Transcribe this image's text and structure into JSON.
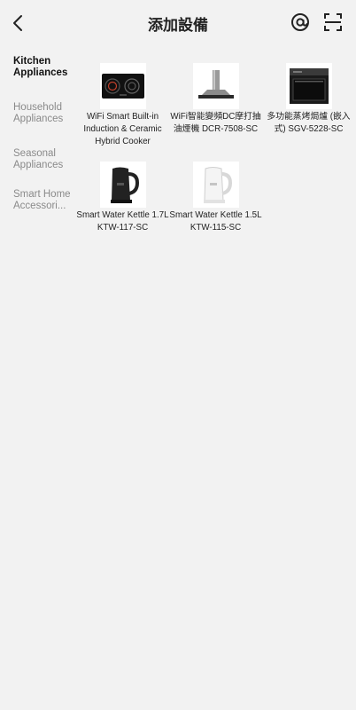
{
  "header": {
    "title": "添加設備"
  },
  "sidebar": {
    "items": [
      {
        "label": "Kitchen Appliances"
      },
      {
        "label": "Household Appliances"
      },
      {
        "label": "Seasonal Appliances"
      },
      {
        "label": "Smart Home Accessori..."
      }
    ]
  },
  "devices": [
    {
      "name": "WiFi  Smart Built-in Induction & Ceramic Hybrid Cooker",
      "icon": "hybrid-cooker-icon"
    },
    {
      "name": "WiFi智能變頻DC摩打抽油煙機 DCR-7508-SC",
      "icon": "range-hood-icon"
    },
    {
      "name": "多功能蒸烤焗爐 (嵌入式) SGV-5228-SC",
      "icon": "steam-oven-icon"
    },
    {
      "name": "Smart Water Kettle 1.7L KTW-117-SC",
      "icon": "black-kettle-icon"
    },
    {
      "name": "Smart Water Kettle 1.5L KTW-115-SC",
      "icon": "white-kettle-icon"
    }
  ]
}
